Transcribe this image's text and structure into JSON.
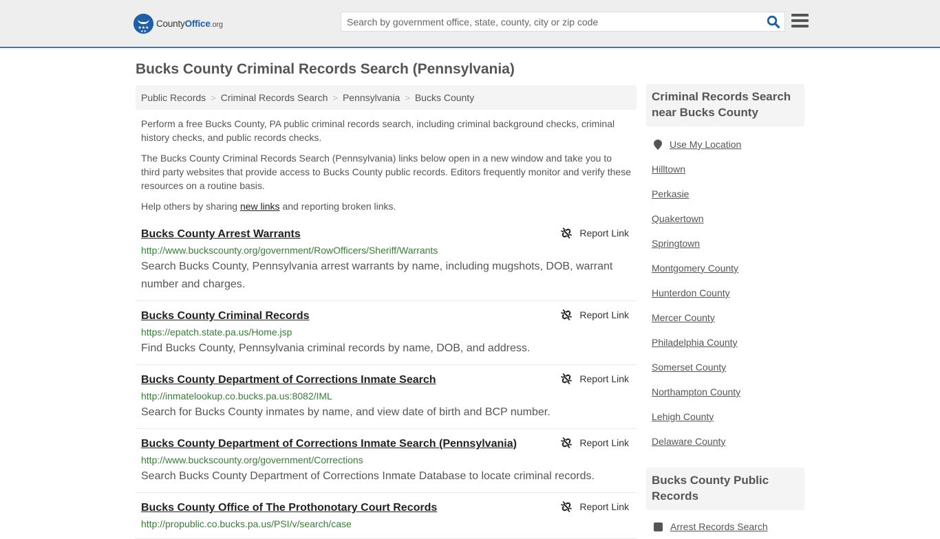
{
  "header": {
    "logo": {
      "brand_plain": "County",
      "brand_bold": "Office",
      "brand_tld": ".org"
    },
    "search": {
      "placeholder": "Search by government office, state, county, city or zip code",
      "value": ""
    }
  },
  "page_title": "Bucks County Criminal Records Search (Pennsylvania)",
  "breadcrumb": [
    {
      "label": "Public Records"
    },
    {
      "label": "Criminal Records Search"
    },
    {
      "label": "Pennsylvania"
    },
    {
      "label": "Bucks County"
    }
  ],
  "breadcrumb_separator": ">",
  "intro": {
    "p1": "Perform a free Bucks County, PA public criminal records search, including criminal background checks, criminal history checks, and public records checks.",
    "p2": "The Bucks County Criminal Records Search (Pennsylvania) links below open in a new window and take you to third party websites that provide access to Bucks County public records. Editors frequently monitor and verify these resources on a routine basis.",
    "p3_before": "Help others by sharing ",
    "p3_link": "new links",
    "p3_after": " and reporting broken links."
  },
  "report_label": "Report Link",
  "links": [
    {
      "title": "Bucks County Arrest Warrants",
      "url": "http://www.buckscounty.org/government/RowOfficers/Sheriff/Warrants",
      "description": "Search Bucks County, Pennsylvania arrest warrants by name, including mugshots, DOB, warrant number and charges."
    },
    {
      "title": "Bucks County Criminal Records",
      "url": "https://epatch.state.pa.us/Home.jsp",
      "description": "Find Bucks County, Pennsylvania criminal records by name, DOB, and address."
    },
    {
      "title": "Bucks County Department of Corrections Inmate Search",
      "url": "http://inmatelookup.co.bucks.pa.us:8082/IML",
      "description": "Search for Bucks County inmates by name, and view date of birth and BCP number."
    },
    {
      "title": "Bucks County Department of Corrections Inmate Search (Pennsylvania)",
      "url": "http://www.buckscounty.org/government/Corrections",
      "description": "Search Bucks County Department of Corrections Inmate Database to locate criminal records."
    },
    {
      "title": "Bucks County Office of The Prothonotary Court Records",
      "url": "http://propublic.co.bucks.pa.us/PSI/v/search/case",
      "description": ""
    }
  ],
  "sidebar": {
    "nearby": {
      "heading": "Criminal Records Search near Bucks County",
      "use_location": "Use My Location",
      "items": [
        "Hilltown",
        "Perkasie",
        "Quakertown",
        "Springtown",
        "Montgomery County",
        "Hunterdon County",
        "Mercer County",
        "Philadelphia County",
        "Somerset County",
        "Northampton County",
        "Lehigh County",
        "Delaware County"
      ]
    },
    "public_records": {
      "heading": "Bucks County Public Records",
      "items": [
        "Arrest Records Search"
      ]
    }
  },
  "colors": {
    "accent": "#3a7bad",
    "brand": "#1f5fa3",
    "url_green": "#3a7a3a"
  }
}
